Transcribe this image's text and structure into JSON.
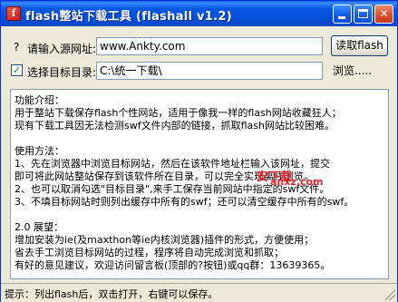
{
  "window": {
    "title": "flash整站下载工具 (flashall v1.2)",
    "app_icon_glyph": "f",
    "minimize_icon": "minimize-icon",
    "maximize_icon": "maximize-icon",
    "close_icon": "close-icon",
    "close_glyph": "✕"
  },
  "source": {
    "help_glyph": "?",
    "label": "请输入源网址:",
    "value": "www.Ankty.com",
    "read_button": "读取flash"
  },
  "target": {
    "checked": true,
    "check_glyph": "✓",
    "label": "选择目标目录:",
    "value": "C:\\统一下载\\",
    "browse_button": "浏览....."
  },
  "memo": {
    "lines": [
      "功能介绍：",
      "用于整站下载保存flash个性网站，适用于像我一样的flash网站收藏狂人；",
      "现有下载工具因无法检测swf文件内部的链接，抓取flash网站比较困难。",
      "",
      "使用方法：",
      "1、先在浏览器中浏览目标网站，然后在该软件地址栏输入该网址，提交",
      "      即可将此网站整站保存到该软件所在目录，可以完全实现离线浏览。",
      "2、也可以取消勾选\"目标目录\",来手工保存当前网站中指定的swf文件。",
      "3、不填目标网站时则列出缓存中所有的swf；还可以清空缓存中所有的swf。",
      "",
      "2.0 展望：",
      "增加安装为ie(及maxthon等ie内核浏览器)插件的形式，方便使用；",
      "省去手工浏览目标网站的过程，程序将自动完成浏览和抓取；",
      "有好的意见建议，欢迎访问留言板(顶部的?按钮)或qq群：13639365。"
    ],
    "watermark_main": "安下载",
    "watermark_sub": "anxz.com"
  },
  "statusbar": {
    "text": "提示：列出flash后，双击打开，右键可以保存。"
  }
}
